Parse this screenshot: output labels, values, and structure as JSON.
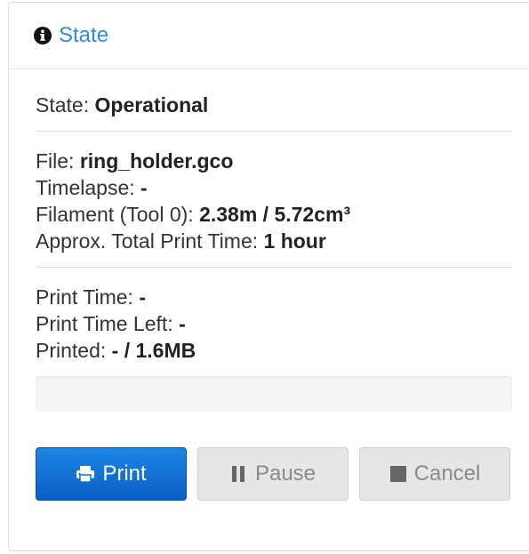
{
  "header": {
    "title": "State",
    "icon": "info-circle-icon"
  },
  "state": {
    "label": "State:",
    "value": "Operational"
  },
  "file_info": {
    "file_label": "File:",
    "file_value": "ring_holder.gco",
    "timelapse_label": "Timelapse:",
    "timelapse_value": "-",
    "filament_label": "Filament (Tool 0):",
    "filament_value": "2.38m / 5.72cm³",
    "approx_label": "Approx. Total Print Time:",
    "approx_value": "1 hour"
  },
  "progress_info": {
    "print_time_label": "Print Time:",
    "print_time_value": "-",
    "time_left_label": "Print Time Left:",
    "time_left_value": "-",
    "printed_label": "Printed:",
    "printed_value": "- / 1.6MB",
    "progress_fraction": 0
  },
  "buttons": {
    "print_label": "Print",
    "print_icon": "printer-icon",
    "pause_label": "Pause",
    "pause_icon": "pause-icon",
    "cancel_label": "Cancel",
    "cancel_icon": "stop-icon"
  },
  "colors": {
    "link": "#2e8dd8",
    "primary": "#0a6fd4",
    "disabled": "#e6e6e6"
  }
}
